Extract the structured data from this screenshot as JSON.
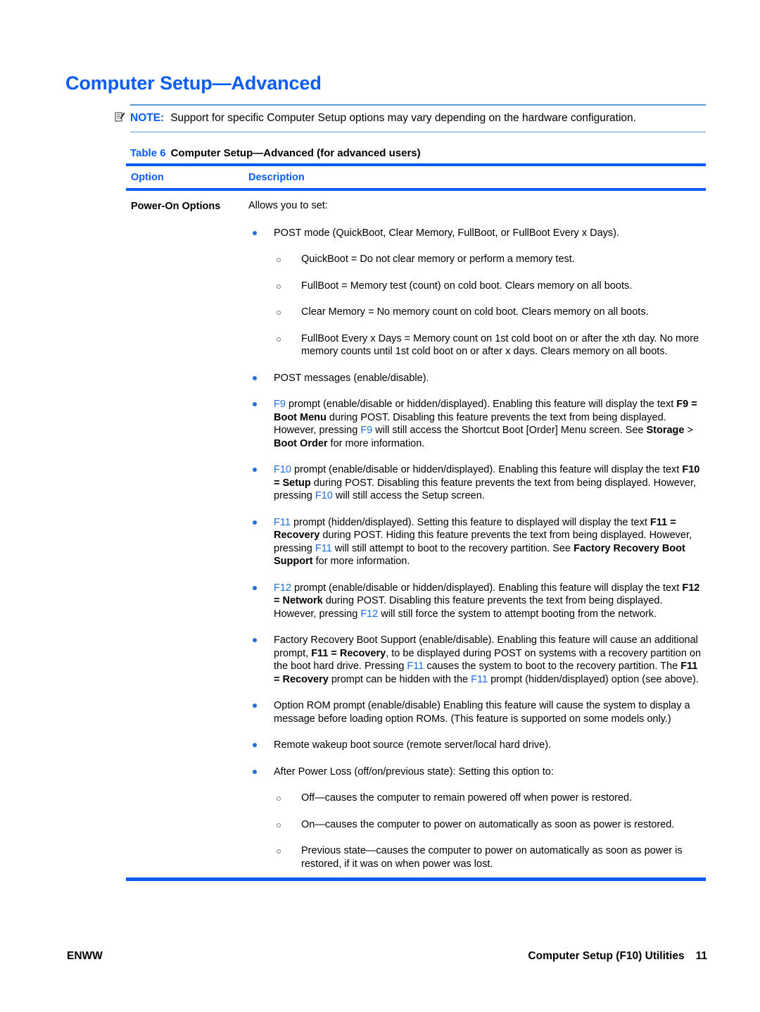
{
  "document": {
    "title": "Computer Setup—Advanced"
  },
  "note": {
    "icon": "note-pencil-icon",
    "label": "NOTE:",
    "text": "Support for specific Computer Setup options may vary depending on the hardware configuration."
  },
  "table_caption": {
    "number": "Table 6",
    "title": "Computer Setup—Advanced (for advanced users)"
  },
  "table": {
    "headers": {
      "option": "Option",
      "description": "Description"
    },
    "row": {
      "option": "Power-On Options",
      "lead": "Allows you to set:"
    }
  },
  "bullets": [
    {
      "id": "post-mode",
      "text": "POST mode (QuickBoot, Clear Memory, FullBoot, or FullBoot Every x Days).",
      "sub": [
        {
          "id": "quickboot",
          "text": "QuickBoot = Do not clear memory or perform a memory test."
        },
        {
          "id": "fullboot",
          "text": "FullBoot = Memory test (count) on cold boot. Clears memory on all boots."
        },
        {
          "id": "clear-memory",
          "text": "Clear Memory = No memory count on cold boot. Clears memory on all boots."
        },
        {
          "id": "fullboot-every-x-days",
          "text": "FullBoot Every x Days = Memory count on 1st cold boot on or after the xth day. No more memory counts until 1st cold boot on or after x days. Clears memory on all boots."
        }
      ]
    },
    {
      "id": "post-messages",
      "text": "POST messages (enable/disable)."
    },
    {
      "id": "f9-prompt",
      "rich": [
        {
          "t": "F9",
          "s": "link"
        },
        {
          "t": " prompt (enable/disable or hidden/displayed). Enabling this feature will display the text ",
          "s": "plain"
        },
        {
          "t": "F9 = Boot Menu",
          "s": "bold"
        },
        {
          "t": " during POST. Disabling this feature prevents the text from being displayed. However, pressing ",
          "s": "plain"
        },
        {
          "t": "F9",
          "s": "link"
        },
        {
          "t": " will still access the Shortcut Boot [Order] Menu screen. See ",
          "s": "plain"
        },
        {
          "t": "Storage",
          "s": "bold"
        },
        {
          "t": " > ",
          "s": "plain"
        },
        {
          "t": "Boot Order",
          "s": "bold"
        },
        {
          "t": " for more information.",
          "s": "plain"
        }
      ]
    },
    {
      "id": "f10-prompt",
      "rich": [
        {
          "t": "F10",
          "s": "link"
        },
        {
          "t": " prompt (enable/disable or hidden/displayed). Enabling this feature will display the text ",
          "s": "plain"
        },
        {
          "t": "F10 = Setup",
          "s": "bold"
        },
        {
          "t": " during POST. Disabling this feature prevents the text from being displayed. However, pressing ",
          "s": "plain"
        },
        {
          "t": "F10",
          "s": "link"
        },
        {
          "t": " will still access the Setup screen.",
          "s": "plain"
        }
      ]
    },
    {
      "id": "f11-prompt",
      "rich": [
        {
          "t": "F11",
          "s": "link"
        },
        {
          "t": " prompt (hidden/displayed). Setting this feature to displayed will display the text ",
          "s": "plain"
        },
        {
          "t": "F11 = Recovery",
          "s": "bold"
        },
        {
          "t": " during POST. Hiding this feature prevents the text from being displayed. However, pressing ",
          "s": "plain"
        },
        {
          "t": "F11",
          "s": "link"
        },
        {
          "t": " will still attempt to boot to the recovery partition. See ",
          "s": "plain"
        },
        {
          "t": "Factory Recovery Boot Support",
          "s": "bold"
        },
        {
          "t": " for more information.",
          "s": "plain"
        }
      ]
    },
    {
      "id": "f12-prompt",
      "rich": [
        {
          "t": "F12",
          "s": "link"
        },
        {
          "t": " prompt (enable/disable or hidden/displayed). Enabling this feature will display the text ",
          "s": "plain"
        },
        {
          "t": "F12 = Network",
          "s": "bold"
        },
        {
          "t": " during POST. Disabling this feature prevents the text from being displayed. However, pressing ",
          "s": "plain"
        },
        {
          "t": "F12",
          "s": "link"
        },
        {
          "t": " will still force the system to attempt booting from the network.",
          "s": "plain"
        }
      ]
    },
    {
      "id": "factory-recovery-boot-support",
      "rich": [
        {
          "t": "Factory Recovery Boot Support (enable/disable). Enabling this feature will cause an additional prompt, ",
          "s": "plain"
        },
        {
          "t": "F11 = Recovery",
          "s": "bold"
        },
        {
          "t": ", to be displayed during POST on systems with a recovery partition on the boot hard drive. Pressing ",
          "s": "plain"
        },
        {
          "t": "F11",
          "s": "link"
        },
        {
          "t": " causes the system to boot to the recovery partition. The ",
          "s": "plain"
        },
        {
          "t": "F11 = Recovery",
          "s": "bold"
        },
        {
          "t": " prompt can be hidden with the ",
          "s": "plain"
        },
        {
          "t": "F11",
          "s": "link"
        },
        {
          "t": " prompt (hidden/displayed) option (see above).",
          "s": "plain"
        }
      ]
    },
    {
      "id": "option-rom-prompt",
      "text": "Option ROM prompt (enable/disable) Enabling this feature will cause the system to display a message before loading option ROMs. (This feature is supported on some models only.)"
    },
    {
      "id": "remote-wakeup-boot-source",
      "text": "Remote wakeup boot source (remote server/local hard drive)."
    },
    {
      "id": "after-power-loss",
      "text": "After Power Loss (off/on/previous state): Setting this option to:",
      "sub": [
        {
          "id": "power-loss-off",
          "text": "Off—causes the computer to remain powered off when power is restored."
        },
        {
          "id": "power-loss-on",
          "text": "On—causes the computer to power on automatically as soon as power is restored."
        },
        {
          "id": "power-loss-previous",
          "text": "Previous state—causes the computer to power on automatically as soon as power is restored, if it was on when power was lost."
        }
      ]
    }
  ],
  "footer": {
    "left": "ENWW",
    "right": "Computer Setup (F10) Utilities",
    "page_number": "11"
  },
  "colors": {
    "heading_blue": "#0a5cf5",
    "rule_blue": "#0a5cf5",
    "note_rule_blue": "#5b9bd5",
    "bullet_blue": "#1f6fe0",
    "link_blue": "#1f6fe0",
    "text_black": "#000000",
    "page_background": "#ffffff"
  }
}
